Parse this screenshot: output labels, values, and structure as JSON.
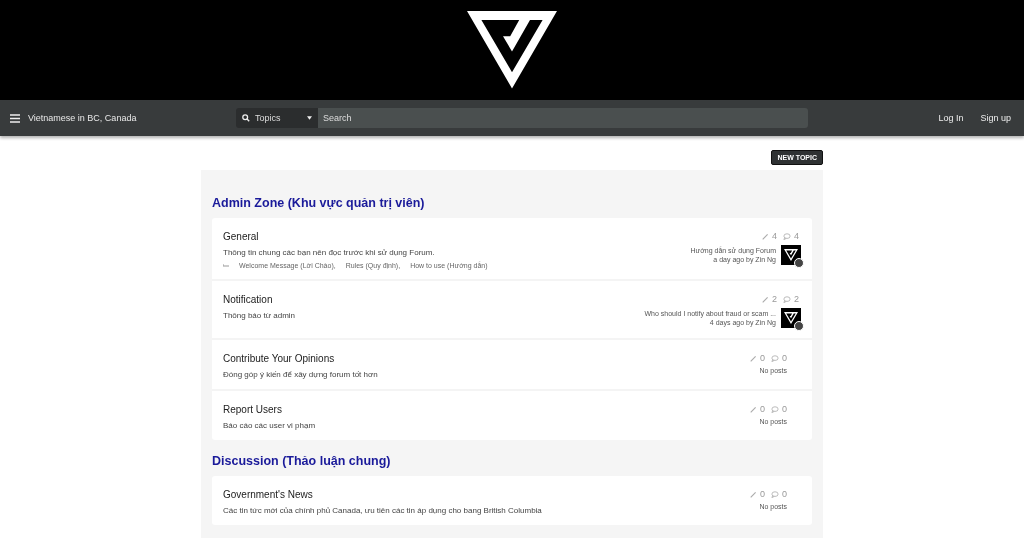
{
  "navbar": {
    "site_title": "Vietnamese in BC, Canada",
    "search_scope": "Topics",
    "search": {
      "placeholder": "Search"
    },
    "links": [
      "Log In",
      "Sign up"
    ]
  },
  "new_topic_button": "NEW TOPIC",
  "categories": [
    {
      "title": "Admin Zone (Khu vực quản trị viên)",
      "forums": [
        {
          "name": "General",
          "description": "Thông tin chung các bạn nên đọc trước khi sử dụng Forum.",
          "subforums": [
            "Welcome Message (Lời Chào),",
            "Rules (Quy định),",
            "How to use (Hướng dẫn)"
          ],
          "topics": "4",
          "posts": "4",
          "last_post": {
            "title": "Hướng dẫn sử dụng Forum",
            "meta": "a day ago by Zin Ng"
          }
        },
        {
          "name": "Notification",
          "description": "Thông báo từ admin",
          "topics": "2",
          "posts": "2",
          "last_post": {
            "title": "Who should I notify about fraud or scam ...",
            "meta": "4 days ago by Zin Ng"
          }
        },
        {
          "name": "Contribute Your Opinions",
          "description": "Đóng góp ý kiến để xây dựng forum tốt hơn",
          "topics": "0",
          "posts": "0",
          "empty_text": "No posts"
        },
        {
          "name": "Report Users",
          "description": "Báo cáo các user vi phạm",
          "topics": "0",
          "posts": "0",
          "empty_text": "No posts"
        }
      ]
    },
    {
      "title": "Discussion (Thảo luận chung)",
      "forums": [
        {
          "name": "Government's News",
          "description": "Các tin tức mới của chính phủ Canada, ưu tiên các tin áp dụng cho bang British Columbia",
          "topics": "0",
          "posts": "0",
          "empty_text": "No posts"
        }
      ]
    }
  ]
}
